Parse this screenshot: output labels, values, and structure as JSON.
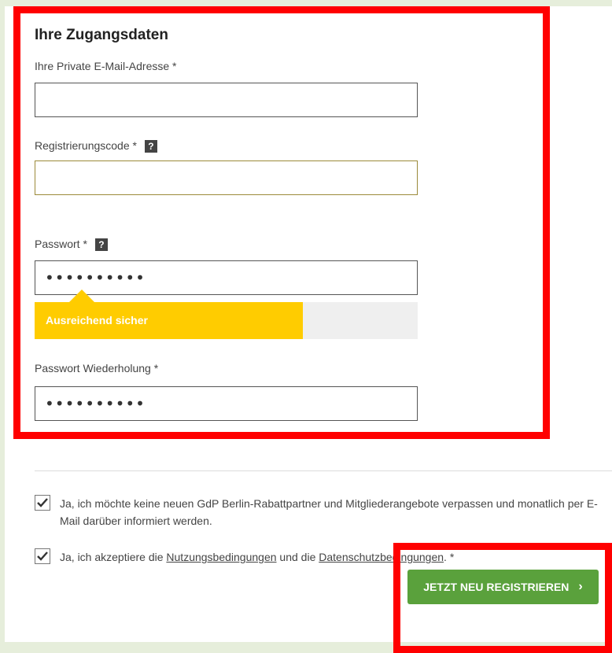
{
  "form": {
    "title": "Ihre Zugangsdaten",
    "email": {
      "label": "Ihre Private E-Mail-Adresse *",
      "value": ""
    },
    "code": {
      "label": "Registrierungscode *",
      "help": "?",
      "value": ""
    },
    "password": {
      "label": "Passwort *",
      "help": "?",
      "value": "••••••••••"
    },
    "strength": {
      "text": "Ausreichend sicher",
      "level": 0.7,
      "color": "#ffcc00"
    },
    "password_repeat": {
      "label": "Passwort Wiederholung *",
      "value": "••••••••••"
    }
  },
  "consents": {
    "newsletter": {
      "checked": true,
      "text": "Ja, ich möchte keine neuen GdP Berlin-Rabattpartner und Mitgliederangebote verpassen und monatlich per E-Mail darüber informiert werden."
    },
    "terms": {
      "checked": true,
      "prefix": "Ja, ich akzeptiere die ",
      "link1": "Nutzungsbedingungen",
      "middle": " und die ",
      "link2": "Datenschutzbedingungen",
      "suffix": ". *"
    }
  },
  "submit": {
    "label": "JETZT NEU REGISTRIEREN",
    "icon": "chevron-right-icon",
    "color": "#5aa13c"
  },
  "colors": {
    "highlight": "#ff0000",
    "background": "#e6eedb"
  }
}
